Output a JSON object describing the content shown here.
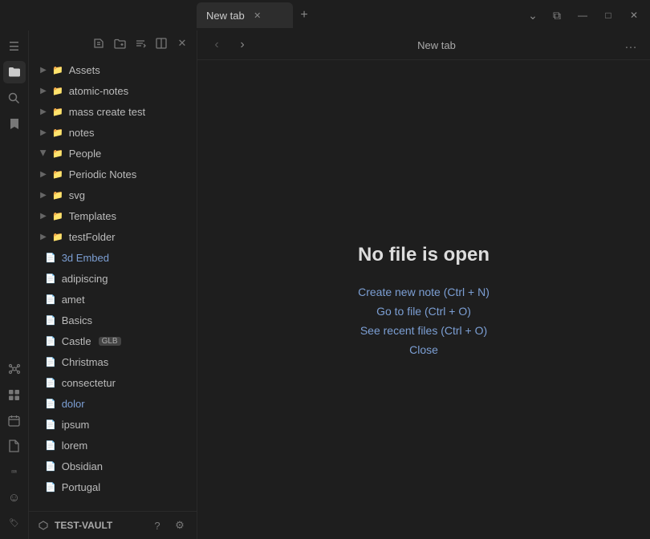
{
  "window": {
    "title": "New tab",
    "minimize": "–",
    "maximize": "□",
    "close": "✕"
  },
  "tab": {
    "label": "New tab",
    "close_icon": "✕",
    "new_tab_icon": "+"
  },
  "titlebar_right": {
    "chevron_down": "⌄",
    "layout": "⧉",
    "minimize": "—",
    "maximize": "□",
    "close": "✕"
  },
  "rail": {
    "icons": [
      {
        "name": "sidebar-toggle-icon",
        "glyph": "☰"
      },
      {
        "name": "folder-icon",
        "glyph": "📁"
      },
      {
        "name": "search-icon",
        "glyph": "🔍"
      },
      {
        "name": "bookmark-icon",
        "glyph": "🔖"
      },
      {
        "name": "graph-icon",
        "glyph": "⬡"
      },
      {
        "name": "blocks-icon",
        "glyph": "⊞"
      },
      {
        "name": "calendar-icon",
        "glyph": "📅"
      },
      {
        "name": "files-icon",
        "glyph": "📄"
      },
      {
        "name": "terminal-icon",
        "glyph": ">_"
      },
      {
        "name": "emoji-icon",
        "glyph": "☺"
      },
      {
        "name": "percent-icon",
        "glyph": "<%"
      }
    ]
  },
  "sidebar": {
    "toolbar_buttons": [
      {
        "name": "new-note-btn",
        "glyph": "✎"
      },
      {
        "name": "new-folder-btn",
        "glyph": "📁"
      },
      {
        "name": "sort-btn",
        "glyph": "↕"
      },
      {
        "name": "split-btn",
        "glyph": "⧉"
      },
      {
        "name": "collapse-btn",
        "glyph": "✕"
      }
    ],
    "tree": [
      {
        "id": "assets",
        "label": "Assets",
        "type": "folder",
        "open": false
      },
      {
        "id": "atomic-notes",
        "label": "atomic-notes",
        "type": "folder",
        "open": false
      },
      {
        "id": "mass-create-test",
        "label": "mass create test",
        "type": "folder",
        "open": false
      },
      {
        "id": "notes",
        "label": "notes",
        "type": "folder",
        "open": false
      },
      {
        "id": "people",
        "label": "People",
        "type": "folder",
        "open": true
      },
      {
        "id": "periodic-notes",
        "label": "Periodic Notes",
        "type": "folder",
        "open": false
      },
      {
        "id": "svg",
        "label": "svg",
        "type": "folder",
        "open": false
      },
      {
        "id": "templates",
        "label": "Templates",
        "type": "folder",
        "open": false
      },
      {
        "id": "testfolder",
        "label": "testFolder",
        "type": "folder",
        "open": false
      },
      {
        "id": "3d-embed",
        "label": "3d Embed",
        "type": "file",
        "highlight": true
      },
      {
        "id": "adipiscing",
        "label": "adipiscing",
        "type": "file"
      },
      {
        "id": "amet",
        "label": "amet",
        "type": "file"
      },
      {
        "id": "basics",
        "label": "Basics",
        "type": "file"
      },
      {
        "id": "castle",
        "label": "Castle",
        "type": "file",
        "badge": "GLB"
      },
      {
        "id": "christmas",
        "label": "Christmas",
        "type": "file"
      },
      {
        "id": "consectetur",
        "label": "consectetur",
        "type": "file"
      },
      {
        "id": "dolor",
        "label": "dolor",
        "type": "file",
        "highlight": true
      },
      {
        "id": "ipsum",
        "label": "ipsum",
        "type": "file"
      },
      {
        "id": "lorem",
        "label": "lorem",
        "type": "file"
      },
      {
        "id": "obsidian",
        "label": "Obsidian",
        "type": "file"
      },
      {
        "id": "portugal",
        "label": "Portugal",
        "type": "file"
      }
    ],
    "footer": {
      "vault_name": "TEST-VAULT",
      "help_icon": "?",
      "settings_icon": "⚙"
    }
  },
  "content": {
    "back_label": "‹",
    "forward_label": "›",
    "title": "New tab",
    "more_label": "…",
    "no_file_title": "No file is open",
    "actions": [
      {
        "id": "create-new",
        "label": "Create new note (Ctrl + N)"
      },
      {
        "id": "go-to-file",
        "label": "Go to file (Ctrl + O)"
      },
      {
        "id": "see-recent",
        "label": "See recent files (Ctrl + O)"
      },
      {
        "id": "close",
        "label": "Close"
      }
    ]
  }
}
